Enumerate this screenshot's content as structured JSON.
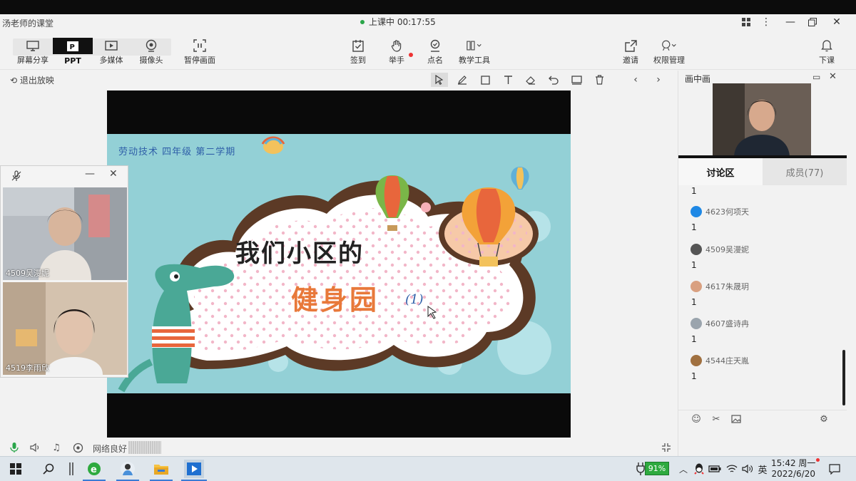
{
  "app": {
    "title": "汤老师的课堂",
    "status": "上课中 00:17:55",
    "accent": "#2aa64a"
  },
  "toolbar": {
    "modes": [
      {
        "label": "屏幕分享",
        "icon": "screen-share-icon"
      },
      {
        "label": "PPT",
        "icon": "ppt-icon"
      },
      {
        "label": "多媒体",
        "icon": "media-icon"
      },
      {
        "label": "摄像头",
        "icon": "camera-icon"
      }
    ],
    "pause": "暂停画面",
    "center": [
      {
        "label": "签到",
        "icon": "signin-icon"
      },
      {
        "label": "举手",
        "icon": "raise-hand-icon"
      },
      {
        "label": "点名",
        "icon": "roll-call-icon"
      },
      {
        "label": "教学工具",
        "icon": "teaching-tools-icon"
      }
    ],
    "right": [
      {
        "label": "邀请",
        "icon": "invite-icon"
      },
      {
        "label": "权限管理",
        "icon": "permission-icon"
      },
      {
        "label": "下课",
        "icon": "end-class-icon"
      }
    ]
  },
  "presentation": {
    "exit": "退出放映"
  },
  "slide": {
    "subtitle": "劳动技术 四年级 第二学期",
    "title_line1": "我们小区的",
    "title_line2": "健身园",
    "title_suffix": "(1)"
  },
  "students": [
    {
      "name": "4509吴漫妮"
    },
    {
      "name": "4519李雨欣"
    }
  ],
  "right_panel": {
    "pip_title": "画中画",
    "tabs": [
      {
        "label": "讨论区"
      },
      {
        "label": "成员(77)"
      }
    ],
    "messages": [
      {
        "name": "",
        "text": "1"
      },
      {
        "name": "4623何项天",
        "text": "1",
        "avatar_color": "#1e88e5"
      },
      {
        "name": "4509吴漫妮",
        "text": "1",
        "avatar_color": "#555555"
      },
      {
        "name": "4617朱晟玥",
        "text": "1",
        "avatar_color": "#d9a080"
      },
      {
        "name": "4607盛诗冉",
        "text": "1",
        "avatar_color": "#9aa4ad"
      },
      {
        "name": "4544庄天胤",
        "text": "1",
        "avatar_color": "#a07040"
      }
    ]
  },
  "bottom": {
    "network": "网络良好"
  },
  "taskbar": {
    "battery": "91%",
    "ime": "英",
    "time": "15:42 周一",
    "date": "2022/6/20"
  }
}
